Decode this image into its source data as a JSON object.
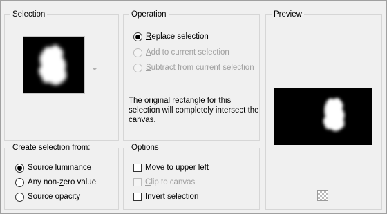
{
  "selection": {
    "title": "Selection",
    "thumbnail_icon": "selection-mask-thumbnail"
  },
  "operation": {
    "title": "Operation",
    "options": [
      {
        "pre": "",
        "key": "R",
        "post": "eplace selection",
        "checked": true,
        "enabled": true
      },
      {
        "pre": "",
        "key": "A",
        "post": "dd to current selection",
        "checked": false,
        "enabled": false
      },
      {
        "pre": "",
        "key": "S",
        "post": "ubtract from current selection",
        "checked": false,
        "enabled": false
      }
    ],
    "message": "The original rectangle for this selection will completely intersect the canvas."
  },
  "preview": {
    "title": "Preview",
    "transparency_icon": "checkerboard-icon"
  },
  "create_from": {
    "title": "Create selection from:",
    "options": [
      {
        "pre": "Source ",
        "key": "l",
        "post": "uminance",
        "checked": true
      },
      {
        "pre": "Any non-",
        "key": "z",
        "post": "ero value",
        "checked": false
      },
      {
        "pre": "S",
        "key": "o",
        "post": "urce opacity",
        "checked": false
      }
    ]
  },
  "options": {
    "title": "Options",
    "checks": [
      {
        "pre": "",
        "key": "M",
        "post": "ove to upper left",
        "checked": false,
        "enabled": true
      },
      {
        "pre": "",
        "key": "C",
        "post": "lip to canvas",
        "checked": false,
        "enabled": false
      },
      {
        "pre": "",
        "key": "I",
        "post": "nvert selection",
        "checked": false,
        "enabled": true
      }
    ]
  },
  "colors": {
    "background": "#f0f0f0",
    "group_border": "#d6d6d6",
    "disabled_text": "#a0a0a0",
    "mask_bg": "#000000",
    "mask_fg": "#ffffff"
  }
}
